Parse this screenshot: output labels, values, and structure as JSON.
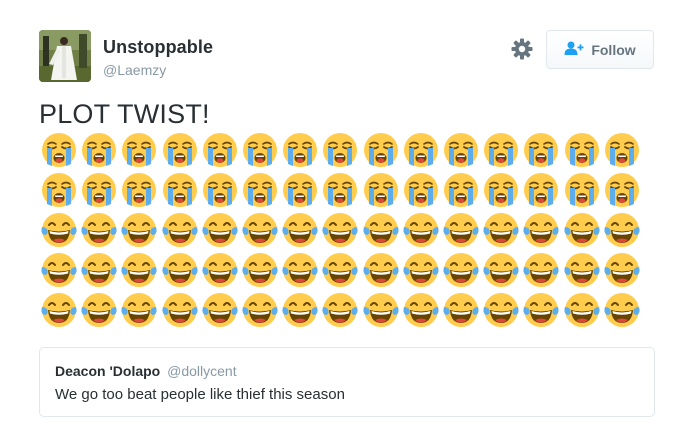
{
  "user": {
    "display_name": "Unstoppable",
    "handle": "@Laemzy",
    "avatar_icon": "user-photo-avatar"
  },
  "actions": {
    "settings_icon": "gear-icon",
    "follow_label": "Follow",
    "follow_icon": "add-user-icon"
  },
  "tweet": {
    "text": "PLOT TWIST!",
    "emoji_rows": [
      {
        "emoji": "loudly-crying-face",
        "count": 15
      },
      {
        "emoji": "loudly-crying-face",
        "count": 15
      },
      {
        "emoji": "face-with-tears-of-joy",
        "count": 15
      },
      {
        "emoji": "face-with-tears-of-joy",
        "count": 15
      },
      {
        "emoji": "face-with-tears-of-joy",
        "count": 15
      }
    ]
  },
  "quoted_tweet": {
    "display_name": "Deacon 'Dolapo",
    "handle": "@dollycent",
    "text": "We go too beat people like thief this season"
  },
  "colors": {
    "text": "#292f33",
    "muted": "#8899a6",
    "border": "#e1e8ed",
    "emoji_yellow": "#ffcc4d",
    "tear_blue": "#5dadec"
  }
}
